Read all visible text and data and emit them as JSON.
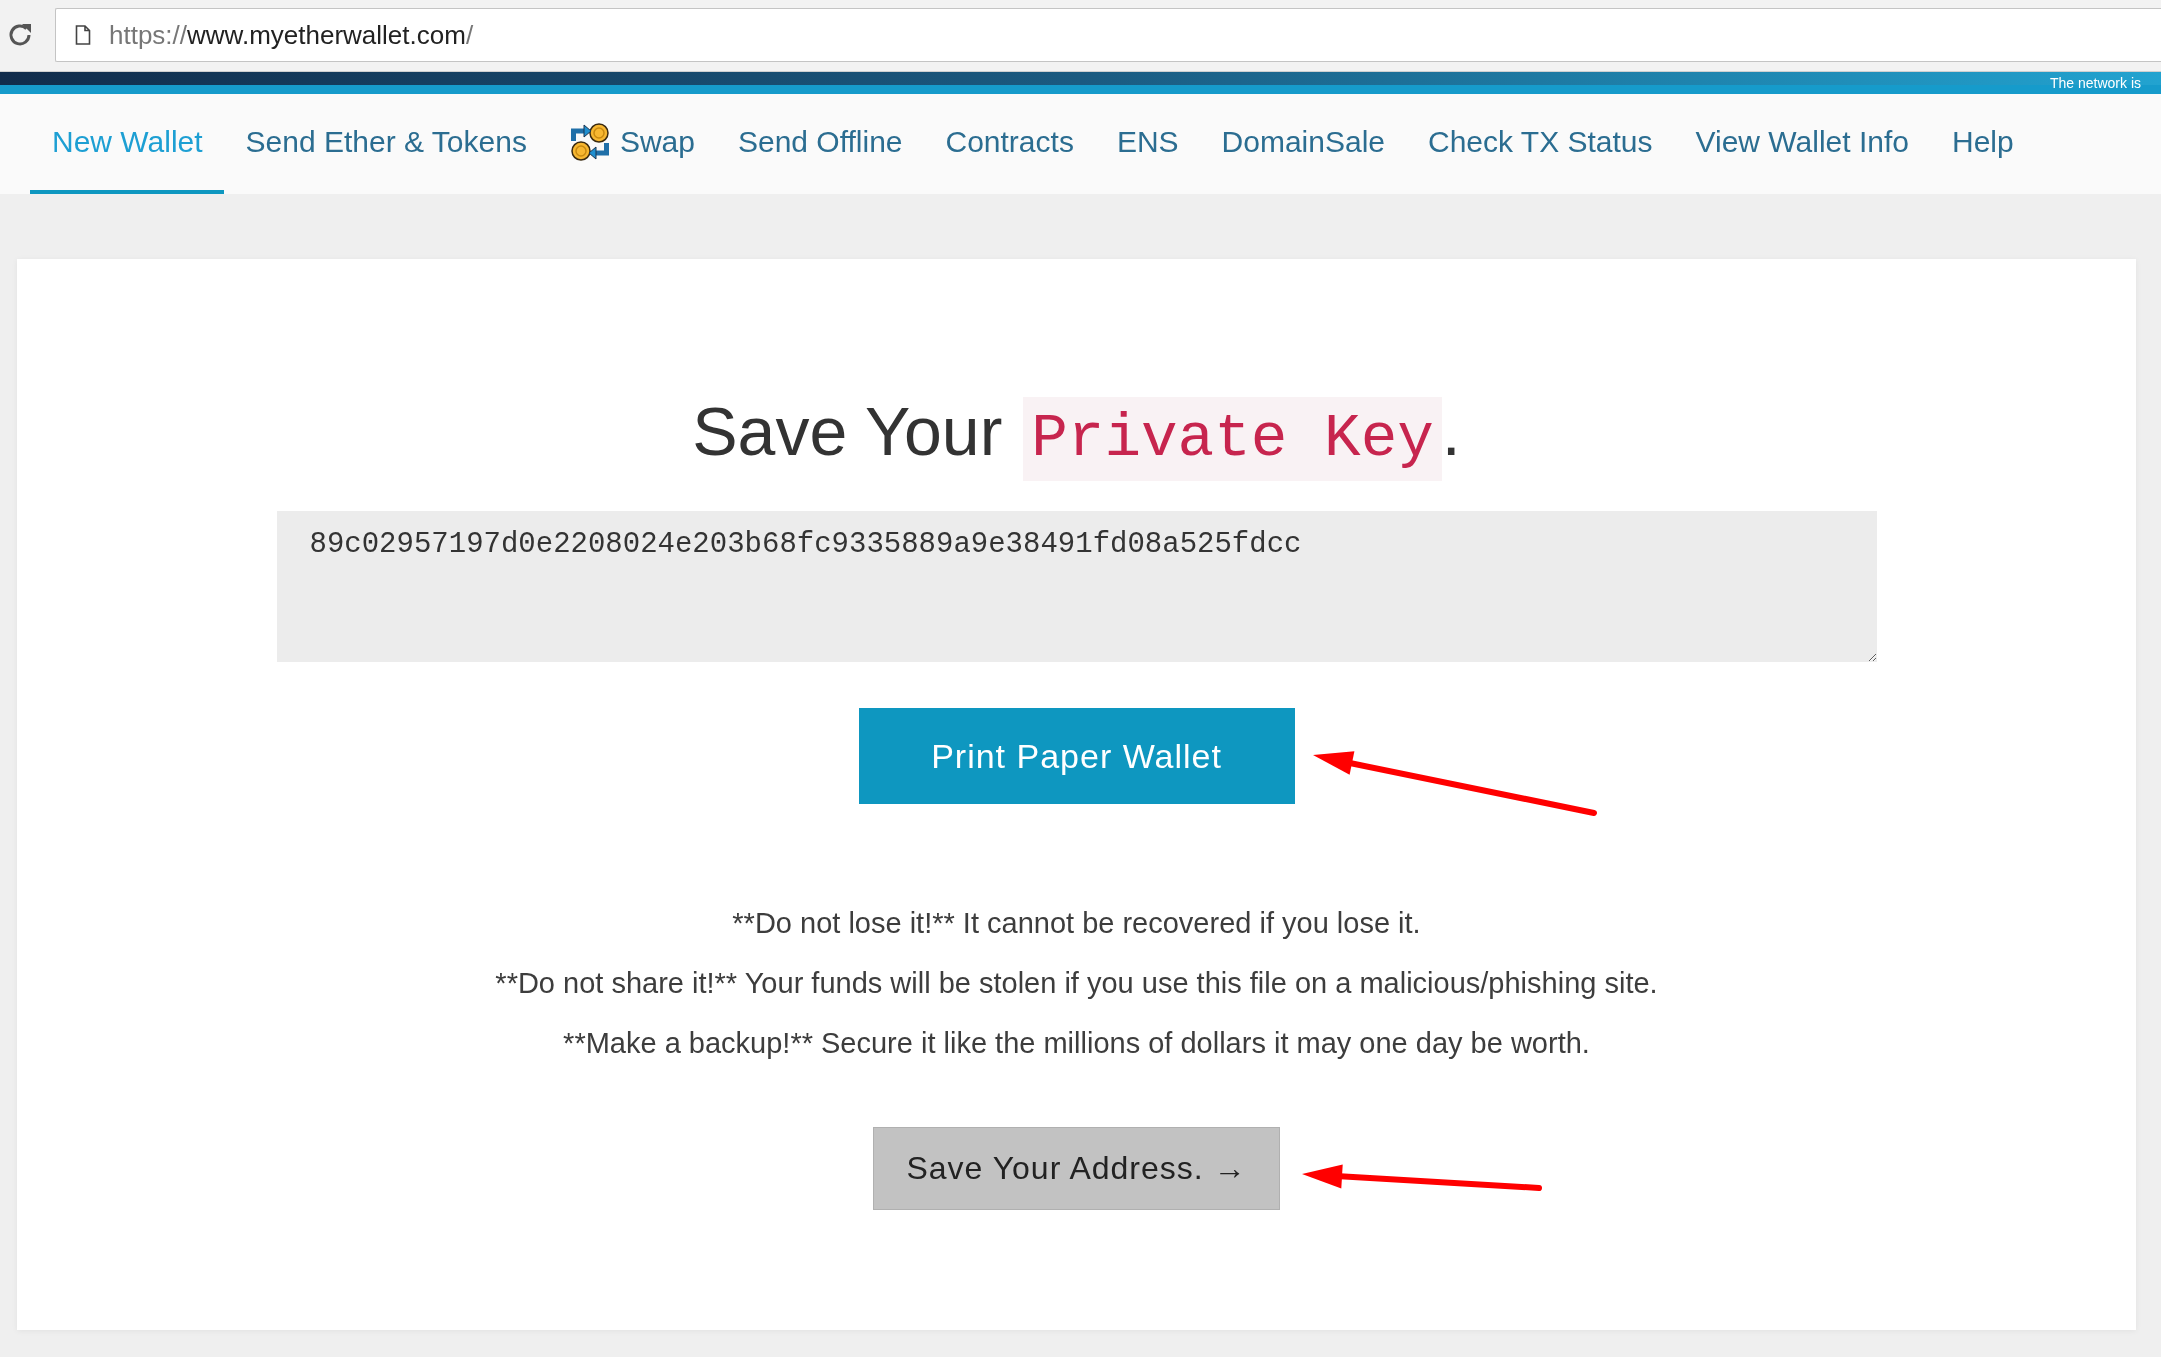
{
  "browser": {
    "url": {
      "scheme": "https://",
      "host": "www.myetherwallet.com",
      "path": "/"
    }
  },
  "header": {
    "notice": "The network is"
  },
  "nav": [
    {
      "label": "New Wallet",
      "selected": true,
      "has_icon": false
    },
    {
      "label": "Send Ether & Tokens",
      "selected": false,
      "has_icon": false
    },
    {
      "label": "Swap",
      "selected": false,
      "has_icon": true
    },
    {
      "label": "Send Offline",
      "selected": false,
      "has_icon": false
    },
    {
      "label": "Contracts",
      "selected": false,
      "has_icon": false
    },
    {
      "label": "ENS",
      "selected": false,
      "has_icon": false
    },
    {
      "label": "DomainSale",
      "selected": false,
      "has_icon": false
    },
    {
      "label": "Check TX Status",
      "selected": false,
      "has_icon": false
    },
    {
      "label": "View Wallet Info",
      "selected": false,
      "has_icon": false
    },
    {
      "label": "Help",
      "selected": false,
      "has_icon": false
    }
  ],
  "title": {
    "parts": [
      {
        "kind": "text",
        "text": "Save Your "
      },
      {
        "kind": "code",
        "text": "Private Key"
      },
      {
        "kind": "text",
        "text": "."
      }
    ]
  },
  "private_key": {
    "value": "89c02957197d0e2208024e203b68fc9335889a9e38491fd08a525fdcc"
  },
  "print_button": "Print Paper Wallet",
  "warnings": [
    "**Do not lose it!** It cannot be recovered if you lose it.",
    "**Do not share it!** Your funds will be stolen if you use this file on a malicious/phishing site.",
    "**Make a backup!** Secure it like the millions of dollars it may one day be worth."
  ],
  "next_button": "Save Your Address. →"
}
